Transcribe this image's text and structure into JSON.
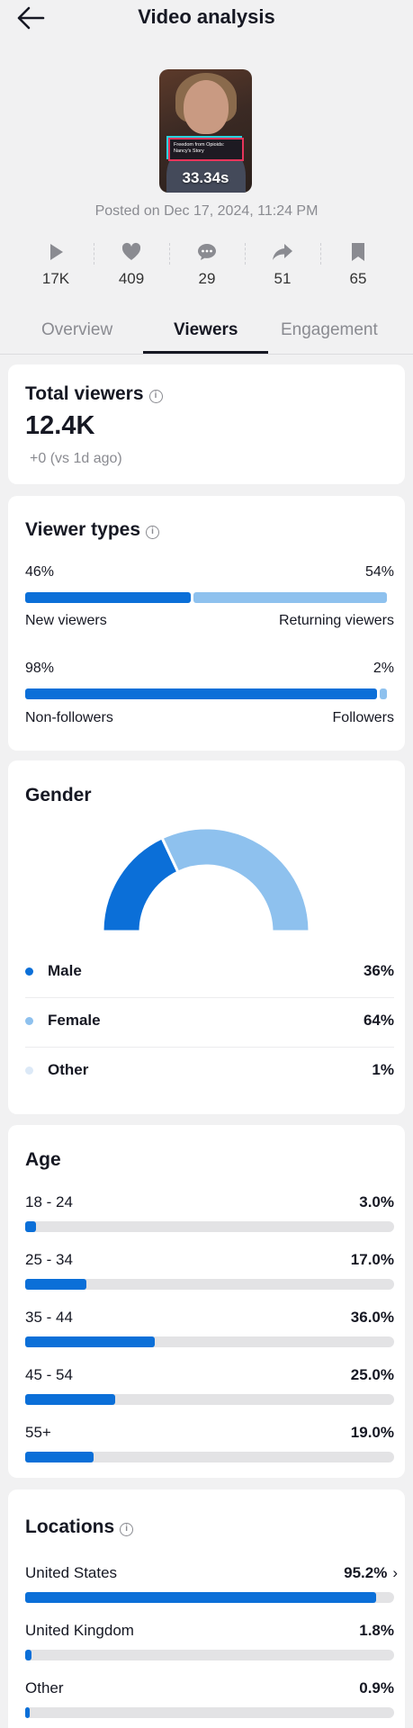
{
  "header": {
    "title": "Video analysis"
  },
  "video": {
    "duration": "33.34s",
    "caption": "Freedom from Opioids: Nancy's Story",
    "posted": "Posted on Dec 17, 2024, 11:24 PM"
  },
  "stats": [
    {
      "icon": "play-icon",
      "value": "17K"
    },
    {
      "icon": "heart-icon",
      "value": "409"
    },
    {
      "icon": "comment-icon",
      "value": "29"
    },
    {
      "icon": "share-icon",
      "value": "51"
    },
    {
      "icon": "bookmark-icon",
      "value": "65"
    }
  ],
  "tabs": [
    {
      "label": "Overview",
      "active": false
    },
    {
      "label": "Viewers",
      "active": true
    },
    {
      "label": "Engagement",
      "active": false
    }
  ],
  "total_viewers": {
    "title": "Total viewers",
    "value": "12.4K",
    "delta": "+0  (vs 1d ago)"
  },
  "viewer_types": {
    "title": "Viewer types",
    "new_returning": {
      "left_pct": "46%",
      "right_pct": "54%",
      "left_label": "New viewers",
      "right_label": "Returning viewers",
      "left_value": 46
    },
    "followers": {
      "left_pct": "98%",
      "right_pct": "2%",
      "left_label": "Non-followers",
      "right_label": "Followers",
      "left_value": 98
    }
  },
  "gender": {
    "title": "Gender",
    "items": [
      {
        "name": "Male",
        "pct": "36%",
        "value": 36,
        "color": "#0b6fd8"
      },
      {
        "name": "Female",
        "pct": "64%",
        "value": 64,
        "color": "#8ec1ee"
      },
      {
        "name": "Other",
        "pct": "1%",
        "value": 1,
        "color": "#dce9f7"
      }
    ]
  },
  "age": {
    "title": "Age",
    "items": [
      {
        "range": "18 - 24",
        "pct": "3.0%",
        "value": 3.0
      },
      {
        "range": "25 - 34",
        "pct": "17.0%",
        "value": 17.0
      },
      {
        "range": "35 - 44",
        "pct": "36.0%",
        "value": 36.0
      },
      {
        "range": "45 - 54",
        "pct": "25.0%",
        "value": 25.0
      },
      {
        "range": "55+",
        "pct": "19.0%",
        "value": 19.0
      }
    ]
  },
  "locations": {
    "title": "Locations",
    "items": [
      {
        "name": "United States",
        "pct": "95.2%",
        "value": 95.2
      },
      {
        "name": "United Kingdom",
        "pct": "1.8%",
        "value": 1.8
      },
      {
        "name": "Other",
        "pct": "0.9%",
        "value": 0.9
      }
    ]
  },
  "colors": {
    "accent": "#0b6fd8",
    "accent_light": "#8ec1ee",
    "track": "#e3e3e5",
    "background": "#f1f1f2"
  }
}
